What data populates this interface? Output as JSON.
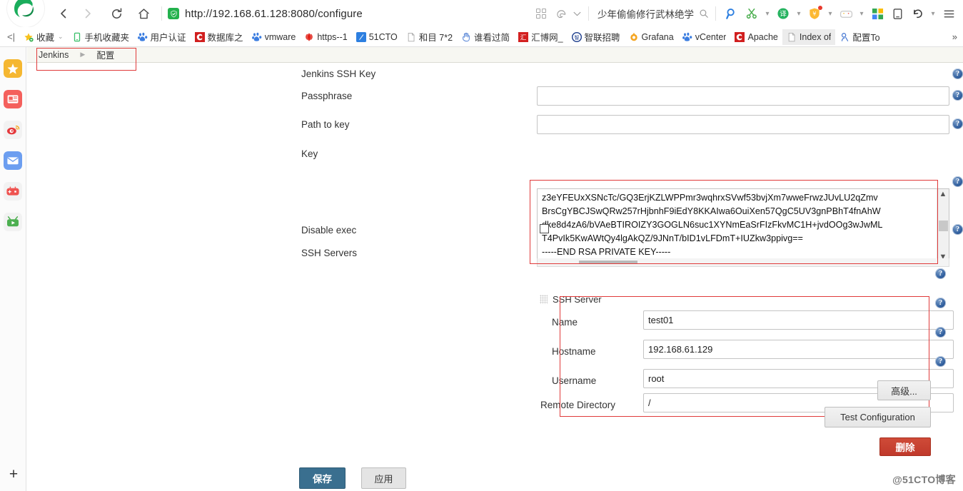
{
  "browser": {
    "nav": {
      "back_icon": "chevron-left-icon",
      "forward_icon": "chevron-right-icon",
      "reload_icon": "reload-icon",
      "home_icon": "home-icon"
    },
    "url": "http://192.168.61.128:8080/configure",
    "ssl_icon": "shield-icon",
    "search_query": "少年偷偷修行武林绝学",
    "search_icon": "search-icon",
    "toolbar_icons": [
      "apps-grid-icon",
      "edge-logo-icon",
      "chevron-down-icon",
      "magnifier-icon",
      "scissors-icon",
      "translate-icon",
      "coupon-icon",
      "game-icon",
      "color-squares-icon",
      "mobile-icon",
      "undo-icon",
      "menu-icon"
    ]
  },
  "bookmarks": {
    "overflow_left_icon": "chevron-left-bar-icon",
    "items": [
      {
        "label": "收藏",
        "icon": "star-icon",
        "has_caret": true,
        "selected": false
      },
      {
        "label": "手机收藏夹",
        "icon": "phone-icon",
        "has_caret": false,
        "selected": false
      },
      {
        "label": "用户认证",
        "icon": "baidu-icon",
        "has_caret": false,
        "selected": false
      },
      {
        "label": "数据库之",
        "icon": "c-red-icon",
        "has_caret": false,
        "selected": false
      },
      {
        "label": "vmware",
        "icon": "baidu-icon",
        "has_caret": false,
        "selected": false
      },
      {
        "label": "https--1",
        "icon": "huawei-icon",
        "has_caret": false,
        "selected": false
      },
      {
        "label": "51CTO",
        "icon": "blue-pen-icon",
        "has_caret": false,
        "selected": false
      },
      {
        "label": "和目 7*2",
        "icon": "page-icon",
        "has_caret": false,
        "selected": false
      },
      {
        "label": "谁看过简",
        "icon": "hand-icon",
        "has_caret": false,
        "selected": false
      },
      {
        "label": "汇博网_",
        "icon": "hui-red-icon",
        "has_caret": false,
        "selected": false
      },
      {
        "label": "智联招聘",
        "icon": "zhilian-icon",
        "has_caret": false,
        "selected": false
      },
      {
        "label": "Grafana",
        "icon": "grafana-icon",
        "has_caret": false,
        "selected": false
      },
      {
        "label": "vCenter",
        "icon": "baidu-icon",
        "has_caret": false,
        "selected": false
      },
      {
        "label": "Apache",
        "icon": "c-red-icon",
        "has_caret": false,
        "selected": false
      },
      {
        "label": "Index of",
        "icon": "page-icon",
        "has_caret": false,
        "selected": true
      },
      {
        "label": "配置To",
        "icon": "person-icon",
        "has_caret": false,
        "selected": false
      }
    ],
    "more_label": "»"
  },
  "left_rail": {
    "items": [
      {
        "name": "favorites-star",
        "icon": "star-icon",
        "color": "#f5b731"
      },
      {
        "name": "news",
        "icon": "news-icon",
        "color": "#f4605c"
      },
      {
        "name": "weibo",
        "icon": "weibo-icon",
        "color": "#e4393c"
      },
      {
        "name": "mail",
        "icon": "mail-icon",
        "color": "#6c9ef0"
      },
      {
        "name": "game",
        "icon": "gamepad-icon",
        "color": "#ef5350"
      },
      {
        "name": "video",
        "icon": "tv-icon",
        "color": "#4caf50"
      }
    ],
    "add_label": "+"
  },
  "page": {
    "breadcrumb": {
      "root": "Jenkins",
      "separator": "▶",
      "current": "配置"
    },
    "fields": {
      "jenkins_ssh_key_label": "Jenkins SSH Key",
      "passphrase_label": "Passphrase",
      "passphrase_value": "",
      "path_to_key_label": "Path to key",
      "path_to_key_value": "",
      "key_label": "Key",
      "key_value": "z3eYFEUxXSNcTc/GQ3ErjKZLWPPmr3wqhrxSVwf53bvjXm7wweFrwzJUvLU2qZmv\nBrsCgYBCJSwQRw257rHjbnhF9iEdY8KKAIwa6OuiXen57QgC5UV3gnPBhT4fnAhW\ndke8d4zA6/bVAeBTIROIZY3GOGLN6suc1XYNmEaSrFIzFkvMC1H+jvdOOg3wJwML\nT4PvIk5KwAWtQy4lgAkQZ/9JNnT/bID1vLFDmT+IUZkw3ppivg==\n-----END RSA PRIVATE KEY-----",
      "disable_exec_label": "Disable exec",
      "disable_exec_checked": false,
      "ssh_servers_label": "SSH Servers"
    },
    "ssh_server": {
      "title": "SSH Server",
      "name_label": "Name",
      "name_value": "test01",
      "hostname_label": "Hostname",
      "hostname_value": "192.168.61.129",
      "username_label": "Username",
      "username_value": "root",
      "remote_directory_label": "Remote Directory",
      "remote_directory_value": "/"
    },
    "buttons": {
      "advanced": "高级...",
      "test_configuration": "Test Configuration",
      "delete": "删除",
      "save": "保存",
      "apply": "应用"
    },
    "help_icon": "help-icon",
    "help_glyph": "?",
    "watermark": "@51CTO博客",
    "accent_red": "#e03a3a",
    "save_blue": "#3a6f8f"
  }
}
